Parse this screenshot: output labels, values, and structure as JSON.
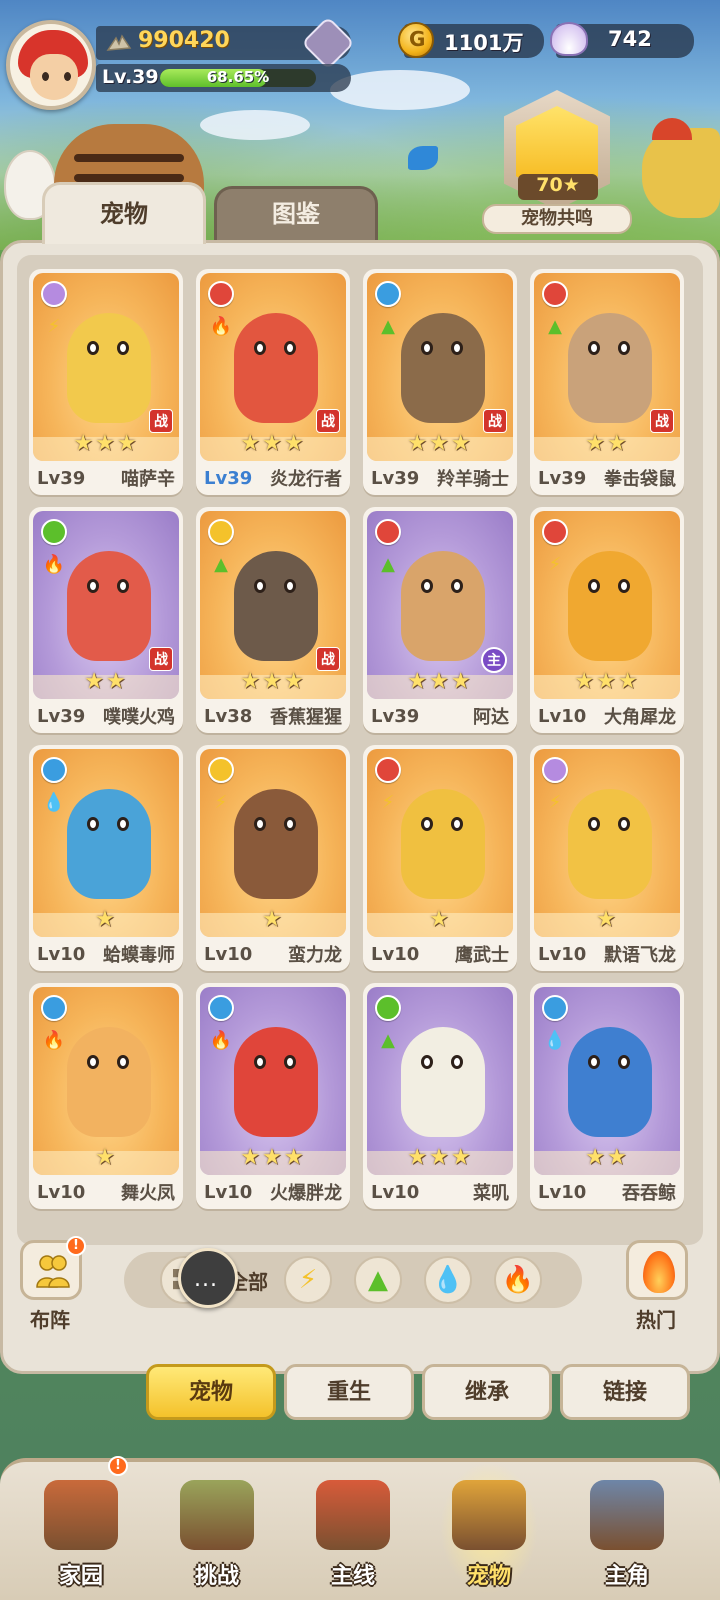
{
  "player": {
    "score": "990420",
    "level_label": "Lv.39",
    "xp_percent_label": "68.65%",
    "xp_fraction": 0.6865
  },
  "currencies": {
    "gold": "1101万",
    "shells": "742"
  },
  "resonance": {
    "stars": "70",
    "label": "宠物共鸣"
  },
  "tabs": {
    "pets": "宠物",
    "codex": "图鉴"
  },
  "pets": [
    {
      "level": "Lv39",
      "name": "喵萨辛",
      "stars": 3,
      "bg": "orange",
      "tag": "战",
      "type_color": "#b58be0",
      "elem": "⚡",
      "elem_color": "#f4c22b",
      "level_color": "gray"
    },
    {
      "level": "Lv39",
      "name": "炎龙行者",
      "stars": 3,
      "bg": "orange",
      "tag": "战",
      "type_color": "#e0463a",
      "elem": "🔥",
      "elem_color": "#e0463a",
      "level_color": "blue"
    },
    {
      "level": "Lv39",
      "name": "羚羊骑士",
      "stars": 3,
      "bg": "orange",
      "tag": "战",
      "type_color": "#3a9de0",
      "elem": "▲",
      "elem_color": "#5cbf2b",
      "level_color": "gray"
    },
    {
      "level": "Lv39",
      "name": "拳击袋鼠",
      "stars": 2,
      "bg": "orange",
      "tag": "战",
      "type_color": "#e0463a",
      "elem": "▲",
      "elem_color": "#5cbf2b",
      "level_color": "gray"
    },
    {
      "level": "Lv39",
      "name": "噗噗火鸡",
      "stars": 2,
      "bg": "purple",
      "tag": "战",
      "type_color": "#5cbf2b",
      "elem": "🔥",
      "elem_color": "#e0463a",
      "level_color": "gray"
    },
    {
      "level": "Lv38",
      "name": "香蕉猩猩",
      "stars": 3,
      "bg": "orange",
      "tag": "战",
      "type_color": "#f4c22b",
      "elem": "▲",
      "elem_color": "#5cbf2b",
      "level_color": "gray"
    },
    {
      "level": "Lv39",
      "name": "阿达",
      "stars": 3,
      "bg": "purple",
      "tag": "主",
      "type_color": "#e0463a",
      "elem": "▲",
      "elem_color": "#5cbf2b",
      "level_color": "gray"
    },
    {
      "level": "Lv10",
      "name": "大角犀龙",
      "stars": 3,
      "bg": "orange",
      "tag": "",
      "type_color": "#e0463a",
      "elem": "⚡",
      "elem_color": "#f4c22b",
      "level_color": "gray"
    },
    {
      "level": "Lv10",
      "name": "蛤蟆毒师",
      "stars": 1,
      "bg": "orange",
      "tag": "",
      "type_color": "#3a9de0",
      "elem": "💧",
      "elem_color": "#3aa8e0",
      "level_color": "gray"
    },
    {
      "level": "Lv10",
      "name": "蛮力龙",
      "stars": 1,
      "bg": "orange",
      "tag": "",
      "type_color": "#f4c22b",
      "elem": "⚡",
      "elem_color": "#f4c22b",
      "level_color": "gray"
    },
    {
      "level": "Lv10",
      "name": "鹰武士",
      "stars": 1,
      "bg": "orange",
      "tag": "",
      "type_color": "#e0463a",
      "elem": "⚡",
      "elem_color": "#f4c22b",
      "level_color": "gray"
    },
    {
      "level": "Lv10",
      "name": "默语飞龙",
      "stars": 1,
      "bg": "orange",
      "tag": "",
      "type_color": "#b58be0",
      "elem": "⚡",
      "elem_color": "#f4c22b",
      "level_color": "gray"
    },
    {
      "level": "Lv10",
      "name": "舞火凤",
      "stars": 1,
      "bg": "orange",
      "tag": "",
      "type_color": "#3a9de0",
      "elem": "🔥",
      "elem_color": "#e0463a",
      "level_color": "gray"
    },
    {
      "level": "Lv10",
      "name": "火爆胖龙",
      "stars": 3,
      "bg": "purple",
      "tag": "",
      "type_color": "#3a9de0",
      "elem": "🔥",
      "elem_color": "#e0463a",
      "level_color": "gray"
    },
    {
      "level": "Lv10",
      "name": "菜叽",
      "stars": 3,
      "bg": "purple",
      "tag": "",
      "type_color": "#5cbf2b",
      "elem": "▲",
      "elem_color": "#5cbf2b",
      "level_color": "gray"
    },
    {
      "level": "Lv10",
      "name": "吞吞鲸",
      "stars": 2,
      "bg": "purple",
      "tag": "",
      "type_color": "#3a9de0",
      "elem": "💧",
      "elem_color": "#3aa8e0",
      "level_color": "gray"
    }
  ],
  "filters": {
    "formation_label": "布阵",
    "all_label": "全部",
    "hot_label": "热门",
    "chat_text": "..."
  },
  "subtabs": [
    "宠物",
    "重生",
    "继承",
    "链接"
  ],
  "bottom_nav": [
    {
      "label": "家园",
      "color": "#c96a3b",
      "badge": true
    },
    {
      "label": "挑战",
      "color": "#9aa45b",
      "badge": false
    },
    {
      "label": "主线",
      "color": "#d85b3a",
      "badge": false
    },
    {
      "label": "宠物",
      "color": "#e0a43a",
      "badge": false,
      "active": true
    },
    {
      "label": "主角",
      "color": "#6e86a8",
      "badge": false
    }
  ],
  "notify_mark": "!"
}
